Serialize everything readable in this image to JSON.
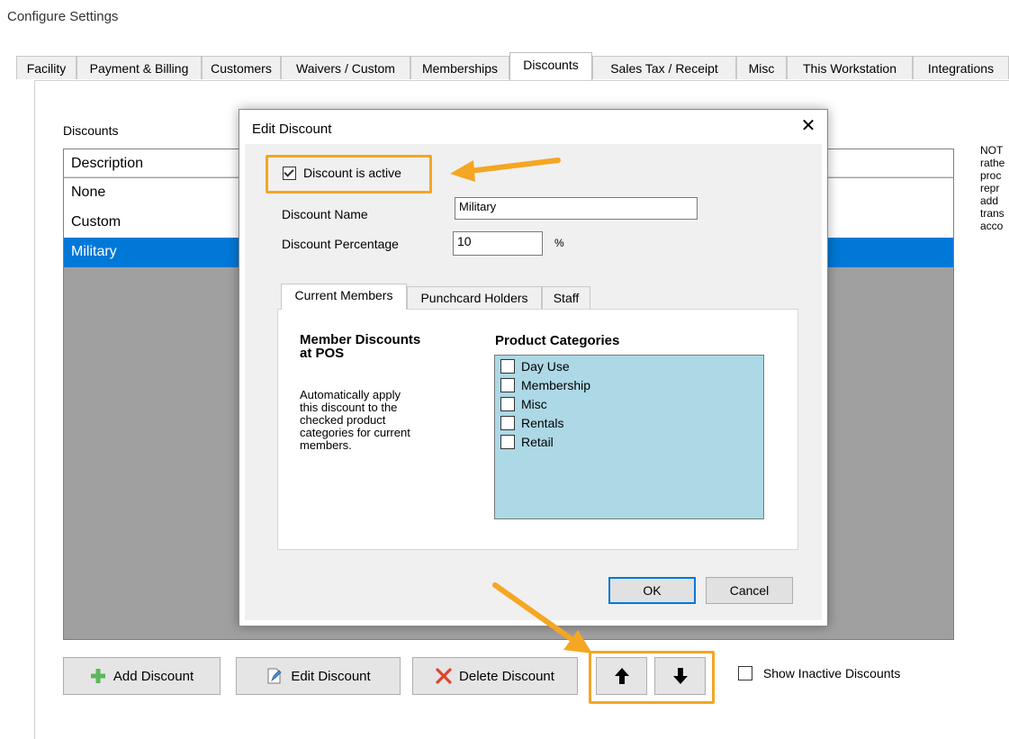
{
  "window": {
    "title": "Configure Settings"
  },
  "tabs": [
    "Facility",
    "Payment & Billing",
    "Customers",
    "Waivers / Custom",
    "Memberships",
    "Discounts",
    "Sales Tax / Receipt",
    "Misc",
    "This Workstation",
    "Integrations"
  ],
  "active_tab": "Discounts",
  "discounts_panel": {
    "label": "Discounts",
    "column_header": "Description",
    "rows": [
      "None",
      "Custom",
      "Military"
    ],
    "selected_row": "Military",
    "note_fragments": [
      "NOT",
      "rathe",
      "proc",
      "repr",
      "add",
      "trans",
      "acco"
    ]
  },
  "buttons": {
    "add": "Add Discount",
    "edit": "Edit Discount",
    "delete": "Delete Discount",
    "move_up": "up-arrow",
    "move_down": "down-arrow"
  },
  "show_inactive": {
    "label": "Show Inactive Discounts",
    "checked": false
  },
  "dialog": {
    "title": "Edit Discount",
    "close_glyph": "✕",
    "active_checkbox": {
      "label": "Discount is active",
      "checked": true
    },
    "name_label": "Discount Name",
    "name_value": "Military",
    "percentage_label": "Discount Percentage",
    "percentage_value": "10",
    "percent_sign": "%",
    "inner_tabs": [
      "Current Members",
      "Punchcard Holders",
      "Staff"
    ],
    "active_inner_tab": "Current Members",
    "section_title_line1": "Member Discounts",
    "section_title_line2": "at POS",
    "section_desc": [
      "Automatically apply",
      "this discount to the",
      "checked product",
      "categories for current",
      "members."
    ],
    "categories_title": "Product Categories",
    "categories": [
      "Day Use",
      "Membership",
      "Misc",
      "Rentals",
      "Retail"
    ],
    "ok": "OK",
    "cancel": "Cancel"
  },
  "annotation_color": "#f5a623",
  "accent_color": "#0078d7"
}
